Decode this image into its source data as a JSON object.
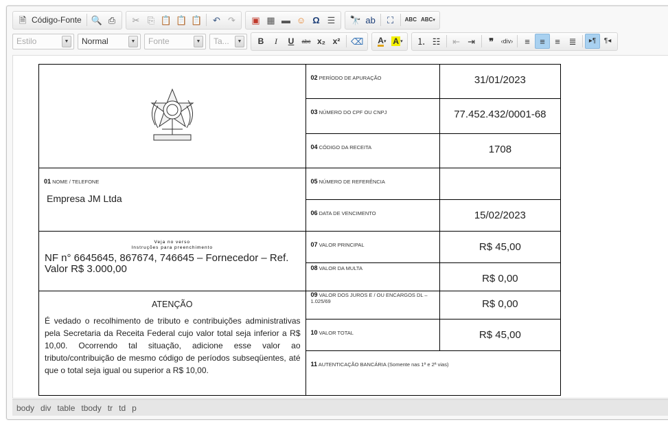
{
  "toolbar": {
    "source_label": "Código-Fonte",
    "style_combo": "Estilo",
    "format_combo": "Normal",
    "font_combo": "Fonte",
    "size_combo": "Ta...",
    "bold": "B",
    "italic": "I",
    "underline": "U",
    "strike": "abc",
    "subscript": "x₂",
    "superscript": "x²",
    "spell1": "ABC",
    "spell2": "ABC",
    "accent_color": "#a9d1f0"
  },
  "document": {
    "f01_num": "01",
    "f01_label": "NOME / TELEFONE",
    "f01_value": "Empresa JM Ltda",
    "instructions": "Veja no verso\nInstruções para preenchimento",
    "nf_text": "NF n° 6645645, 867674, 746645 – Fornecedor – Ref. Valor R$ 3.000,00",
    "attention_title": "ATENÇÃO",
    "attention_text": "É vedado o recolhimento de tributo e contribuições administrativas pela Secretaria da Receita Federal cujo valor total seja inferior a R$ 10,00. Ocorrendo tal situação, adicione esse valor ao tributo/contribuição de mesmo código de períodos subseqüentes, até que o total seja igual ou superior a R$ 10,00.",
    "fields": [
      {
        "num": "02",
        "label": "PERÍODO DE APURAÇÃO",
        "value": "31/01/2023"
      },
      {
        "num": "03",
        "label": "NÚMERO DO CPF OU CNPJ",
        "value": "77.452.432/0001-68"
      },
      {
        "num": "04",
        "label": "CÓDIGO DA RECEITA",
        "value": "1708"
      },
      {
        "num": "05",
        "label": "NÚMERO DE REFERÊNCIA",
        "value": ""
      },
      {
        "num": "06",
        "label": "DATA DE VENCIMENTO",
        "value": "15/02/2023"
      },
      {
        "num": "07",
        "label": "VALOR PRINCIPAL",
        "value": "R$ 45,00"
      },
      {
        "num": "08",
        "label": "VALOR DA MULTA",
        "value": "R$ 0,00"
      },
      {
        "num": "09",
        "label": "VALOR DOS JUROS E / OU  ENCARGOS DL – 1.025/69",
        "value": "R$ 0,00"
      },
      {
        "num": "10",
        "label": "VALOR TOTAL",
        "value": "R$ 45,00"
      },
      {
        "num": "11",
        "label": "AUTENTICAÇÃO BANCÁRIA (Somente nas 1ª e 2ª vias)",
        "value": ""
      }
    ]
  },
  "statusbar": {
    "path": [
      "body",
      "div",
      "table",
      "tbody",
      "tr",
      "td",
      "p"
    ]
  }
}
